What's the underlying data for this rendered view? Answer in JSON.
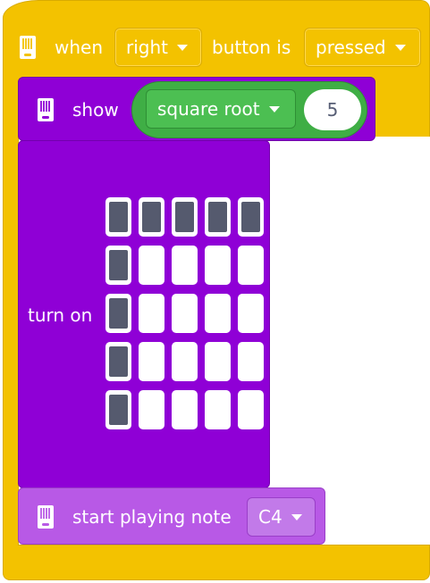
{
  "event_block": {
    "label_when": "when",
    "button_dropdown": "right",
    "label_button_is": "button is",
    "state_dropdown": "pressed",
    "color": "#f3c200"
  },
  "show_block": {
    "label": "show",
    "operator_dropdown": "square root",
    "operand": "5",
    "color": "#8f00d6",
    "reporter_color": "#3fae45"
  },
  "turn_on_block": {
    "label": "turn on",
    "matrix": [
      [
        1,
        1,
        1,
        1,
        1
      ],
      [
        1,
        0,
        0,
        0,
        0
      ],
      [
        1,
        0,
        0,
        0,
        0
      ],
      [
        1,
        0,
        0,
        0,
        0
      ],
      [
        1,
        0,
        0,
        0,
        0
      ]
    ]
  },
  "note_block": {
    "label": "start playing note",
    "note_dropdown": "C4",
    "color": "#b859e6"
  },
  "icons": [
    "hub-icon",
    "chevron-down-icon"
  ]
}
